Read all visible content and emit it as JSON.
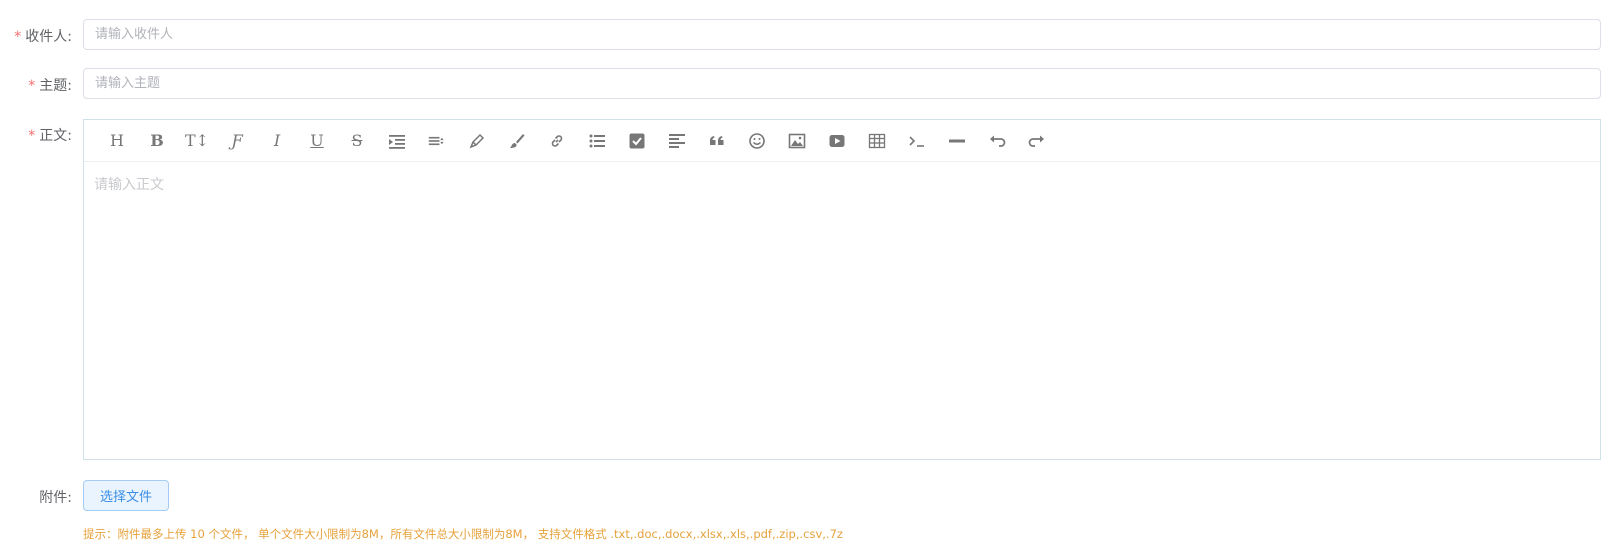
{
  "form": {
    "recipient": {
      "label": "收件人:",
      "placeholder": "请输入收件人"
    },
    "subject": {
      "label": "主题:",
      "placeholder": "请输入主题"
    },
    "body": {
      "label": "正文:",
      "placeholder": "请输入正文"
    },
    "attachment": {
      "label": "附件:",
      "button_label": "选择文件"
    },
    "required_mark": "*",
    "hint": "提示：附件最多上传 10 个文件， 单个文件大小限制为8M，所有文件总大小限制为8M， 支持文件格式 .txt,.doc,.docx,.xlsx,.xls,.pdf,.zip,.csv,.7z"
  },
  "toolbar": {
    "items": [
      {
        "name": "heading-icon",
        "glyph": "H"
      },
      {
        "name": "bold-icon",
        "glyph": "B"
      },
      {
        "name": "font-size-icon",
        "glyph": "T↕"
      },
      {
        "name": "font-family-icon",
        "glyph": "F"
      },
      {
        "name": "italic-icon",
        "glyph": "I"
      },
      {
        "name": "underline-icon",
        "glyph": "U"
      },
      {
        "name": "strikethrough-icon",
        "glyph": "S"
      },
      {
        "name": "indent-icon"
      },
      {
        "name": "line-height-icon"
      },
      {
        "name": "pen-icon"
      },
      {
        "name": "brush-icon"
      },
      {
        "name": "link-icon"
      },
      {
        "name": "bullet-list-icon"
      },
      {
        "name": "checkbox-icon"
      },
      {
        "name": "align-left-icon"
      },
      {
        "name": "quote-icon"
      },
      {
        "name": "emoji-icon"
      },
      {
        "name": "image-icon"
      },
      {
        "name": "video-icon"
      },
      {
        "name": "table-icon"
      },
      {
        "name": "code-icon"
      },
      {
        "name": "horizontal-rule-icon"
      },
      {
        "name": "undo-icon"
      },
      {
        "name": "redo-icon"
      }
    ]
  },
  "colors": {
    "required": "#f56c6c",
    "hint": "#e6a23c",
    "button_text": "#3a8ee6",
    "button_bg": "#eaf4ff"
  }
}
